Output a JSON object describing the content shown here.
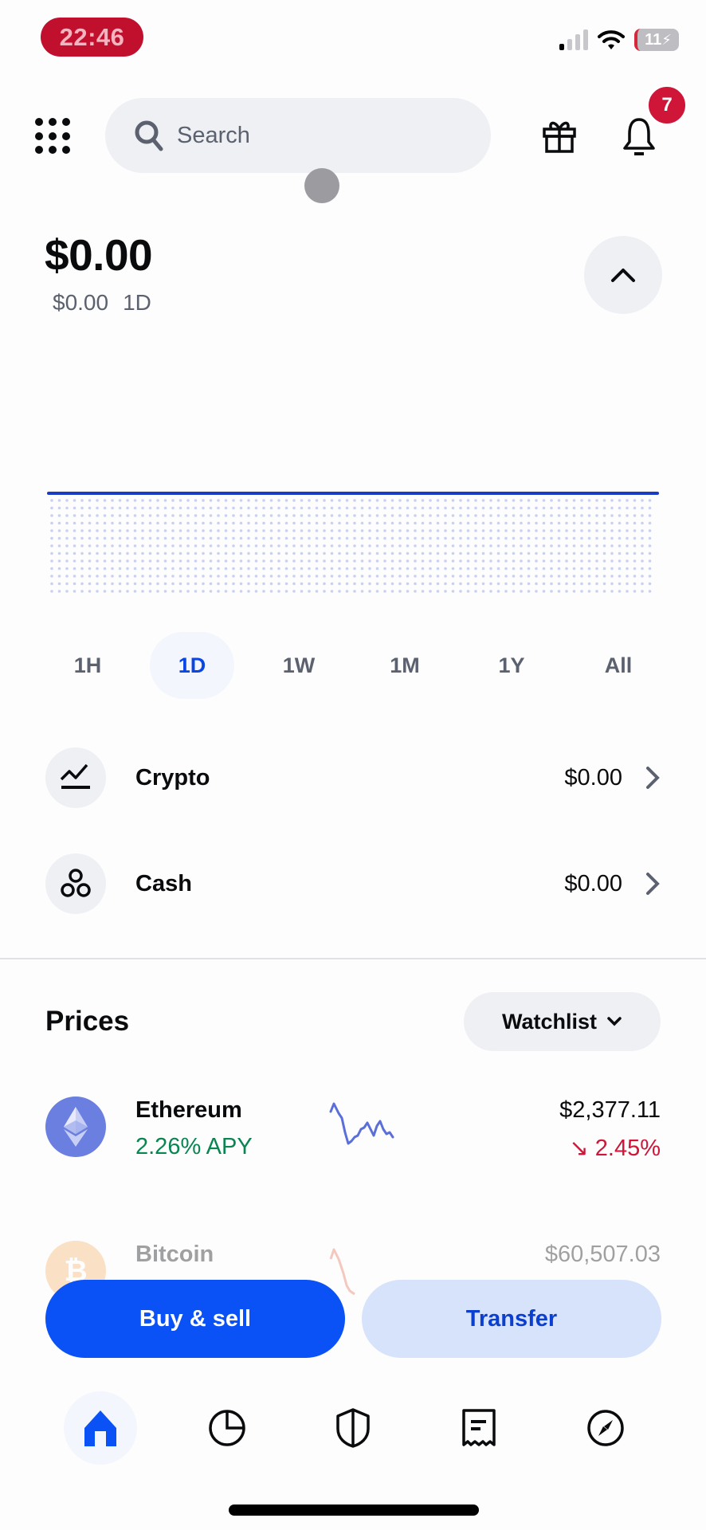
{
  "status_bar": {
    "time": "22:46",
    "battery": "11"
  },
  "header": {
    "search_placeholder": "Search",
    "notification_count": "7"
  },
  "balance": {
    "total": "$0.00",
    "change_amount": "$0.00",
    "change_period": "1D"
  },
  "chart": {
    "line_color": "#1a3cc4",
    "fill_color": "#c9d1f2",
    "value": 0
  },
  "timeframes": {
    "tabs": [
      {
        "label": "1H",
        "active": false
      },
      {
        "label": "1D",
        "active": true
      },
      {
        "label": "1W",
        "active": false
      },
      {
        "label": "1M",
        "active": false
      },
      {
        "label": "1Y",
        "active": false
      },
      {
        "label": "All",
        "active": false
      }
    ]
  },
  "assets": [
    {
      "label": "Crypto",
      "value": "$0.00",
      "icon": "chart-line-icon"
    },
    {
      "label": "Cash",
      "value": "$0.00",
      "icon": "coins-icon"
    }
  ],
  "prices": {
    "title": "Prices",
    "filter_label": "Watchlist",
    "coins": [
      {
        "name": "Ethereum",
        "subtitle": "2.26% APY",
        "subtitle_color": "#098551",
        "price": "$2,377.11",
        "change": "2.45%",
        "direction": "down",
        "change_color": "#cf1538",
        "icon_color": "#6a7fe0",
        "spark_color": "#5b6fd9"
      },
      {
        "name": "Bitcoin",
        "subtitle": "",
        "price": "$60,507.03",
        "icon_color": "#f7931a",
        "spark_color": "#e8735a"
      }
    ]
  },
  "actions": {
    "buy_label": "Buy & sell",
    "transfer_label": "Transfer"
  },
  "nav": {
    "items": [
      {
        "name": "home",
        "active": true
      },
      {
        "name": "portfolio",
        "active": false
      },
      {
        "name": "security",
        "active": false
      },
      {
        "name": "transactions",
        "active": false
      },
      {
        "name": "explore",
        "active": false
      }
    ]
  },
  "colors": {
    "brand": "#0a52f5",
    "negative": "#cf1538",
    "positive": "#098551"
  }
}
